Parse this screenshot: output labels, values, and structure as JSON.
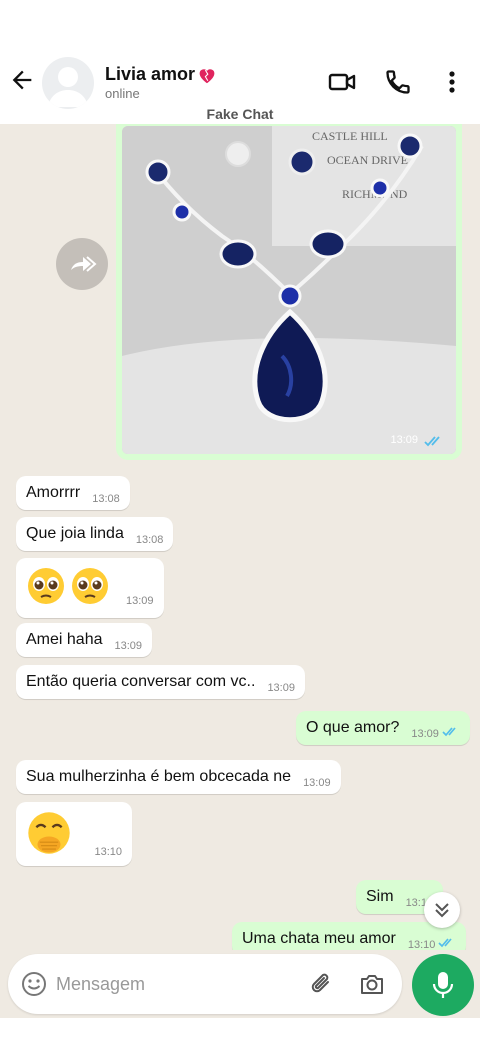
{
  "header": {
    "contact_name": "Livia amor",
    "contact_status": "online",
    "watermark": "Fake Chat"
  },
  "image_message": {
    "time": "13:09",
    "card_text": [
      "CASTLE HILL",
      "OCEAN DRIVE",
      "RICHMOND"
    ],
    "status": "read"
  },
  "messages": [
    {
      "dir": "in",
      "text": "Amorrrr",
      "time": "13:08"
    },
    {
      "dir": "in",
      "text": "Que joia linda",
      "time": "13:08"
    },
    {
      "dir": "in",
      "text": "🥹🥹",
      "time": "13:09",
      "kind": "emoji",
      "emoji_name": "pleading-face"
    },
    {
      "dir": "in",
      "text": "Amei haha",
      "time": "13:09"
    },
    {
      "dir": "in",
      "text": "Então queria conversar com vc..",
      "time": "13:09"
    },
    {
      "dir": "out",
      "text": "O que amor?",
      "time": "13:09",
      "status": "read"
    },
    {
      "dir": "in",
      "text": "Sua mulherzinha é bem obcecada ne",
      "time": "13:09"
    },
    {
      "dir": "in",
      "text": "🤭",
      "time": "13:10",
      "kind": "emoji",
      "emoji_name": "hand-over-mouth-face"
    },
    {
      "dir": "out",
      "text": "Sim",
      "time": "13:10",
      "status": "read"
    },
    {
      "dir": "out",
      "text": "Uma chata meu amor",
      "time": "13:10",
      "status": "read"
    }
  ],
  "composer": {
    "placeholder": "Mensagem"
  },
  "colors": {
    "outgoing_bubble": "#d9fdd3",
    "incoming_bubble": "#ffffff",
    "chat_background": "#efeae2",
    "accent": "#1daa61",
    "read_ticks": "#53bdeb"
  },
  "icons": {
    "back": "arrow-left-icon",
    "video": "video-camera-icon",
    "call": "phone-icon",
    "menu": "more-vertical-icon",
    "forward": "forward-icon",
    "emoji": "smiley-icon",
    "attach": "paperclip-icon",
    "camera": "camera-icon",
    "mic": "microphone-icon",
    "scroll": "chevron-double-down-icon"
  }
}
